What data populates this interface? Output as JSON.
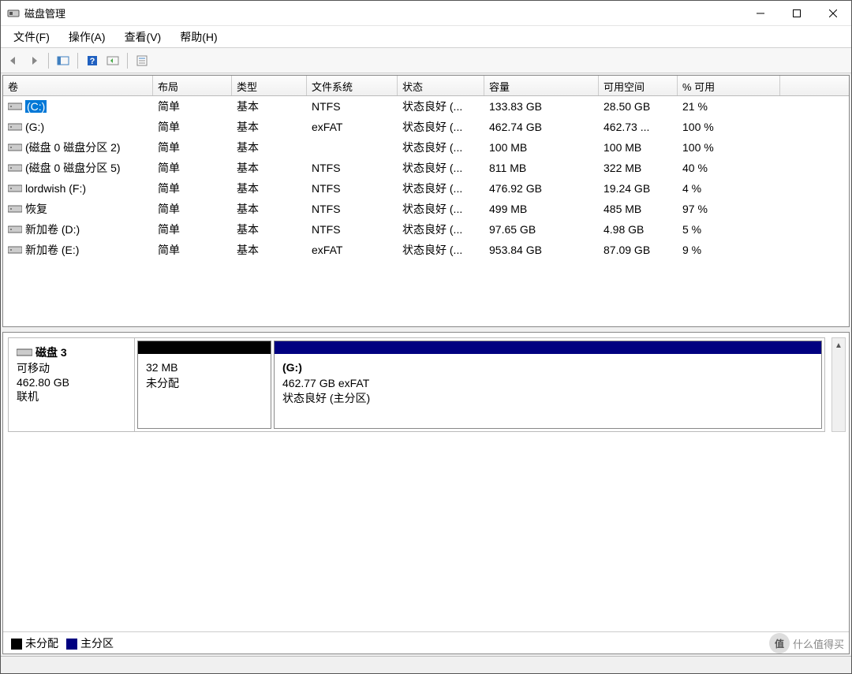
{
  "window": {
    "title": "磁盘管理"
  },
  "menu": {
    "file": "文件(F)",
    "action": "操作(A)",
    "view": "查看(V)",
    "help": "帮助(H)"
  },
  "columns": {
    "volume": "卷",
    "layout": "布局",
    "type": "类型",
    "fs": "文件系统",
    "status": "状态",
    "capacity": "容量",
    "free": "可用空间",
    "pctfree": "% 可用"
  },
  "volumes": [
    {
      "name": "(C:)",
      "layout": "简单",
      "type": "基本",
      "fs": "NTFS",
      "status": "状态良好 (...",
      "capacity": "133.83 GB",
      "free": "28.50 GB",
      "pct": "21 %",
      "selected": true
    },
    {
      "name": "(G:)",
      "layout": "简单",
      "type": "基本",
      "fs": "exFAT",
      "status": "状态良好 (...",
      "capacity": "462.74 GB",
      "free": "462.73 ...",
      "pct": "100 %"
    },
    {
      "name": "(磁盘 0 磁盘分区 2)",
      "layout": "简单",
      "type": "基本",
      "fs": "",
      "status": "状态良好 (...",
      "capacity": "100 MB",
      "free": "100 MB",
      "pct": "100 %"
    },
    {
      "name": "(磁盘 0 磁盘分区 5)",
      "layout": "简单",
      "type": "基本",
      "fs": "NTFS",
      "status": "状态良好 (...",
      "capacity": "811 MB",
      "free": "322 MB",
      "pct": "40 %"
    },
    {
      "name": "lordwish (F:)",
      "layout": "简单",
      "type": "基本",
      "fs": "NTFS",
      "status": "状态良好 (...",
      "capacity": "476.92 GB",
      "free": "19.24 GB",
      "pct": "4 %"
    },
    {
      "name": "恢复",
      "layout": "简单",
      "type": "基本",
      "fs": "NTFS",
      "status": "状态良好 (...",
      "capacity": "499 MB",
      "free": "485 MB",
      "pct": "97 %"
    },
    {
      "name": "新加卷 (D:)",
      "layout": "简单",
      "type": "基本",
      "fs": "NTFS",
      "status": "状态良好 (...",
      "capacity": "97.65 GB",
      "free": "4.98 GB",
      "pct": "5 %"
    },
    {
      "name": "新加卷 (E:)",
      "layout": "简单",
      "type": "基本",
      "fs": "exFAT",
      "status": "状态良好 (...",
      "capacity": "953.84 GB",
      "free": "87.09 GB",
      "pct": "9 %"
    }
  ],
  "disk": {
    "title": "磁盘 3",
    "kind": "可移动",
    "size": "462.80 GB",
    "state": "联机",
    "unalloc_size": "32 MB",
    "unalloc_label": "未分配",
    "part_name": "(G:)",
    "part_desc": "462.77 GB exFAT",
    "part_status": "状态良好 (主分区)"
  },
  "legend": {
    "unalloc": "未分配",
    "primary": "主分区"
  },
  "watermark": {
    "text": "什么值得买",
    "badge": "值"
  }
}
